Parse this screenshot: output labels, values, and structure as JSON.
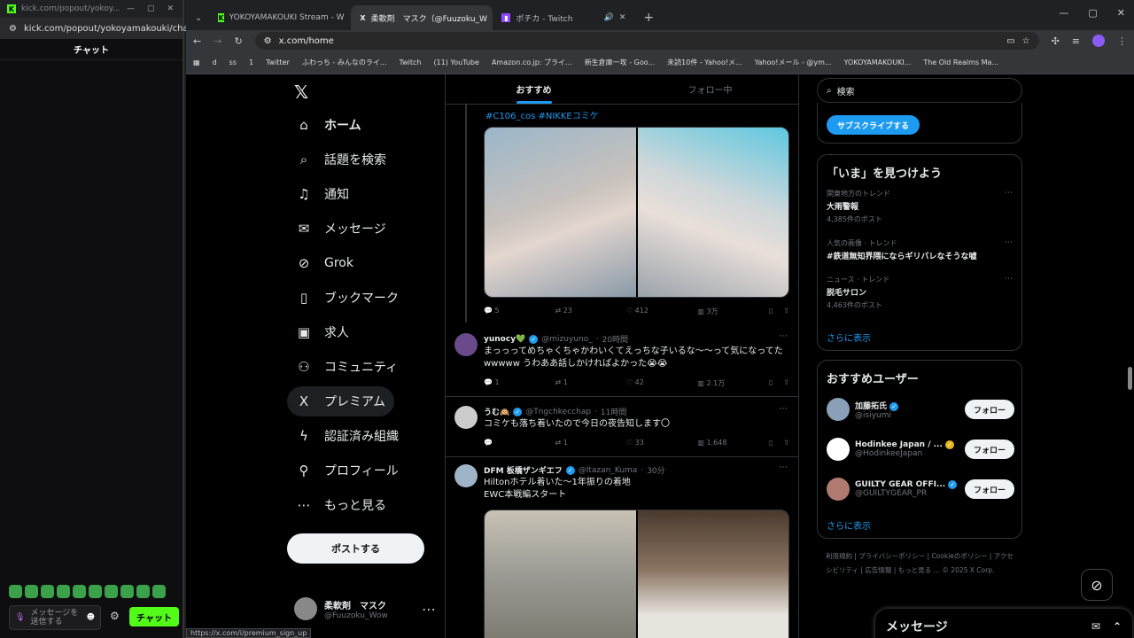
{
  "left_window": {
    "title": "kick.com/popout/yokoy...",
    "url": "kick.com/popout/yokoyamakouki/chat",
    "chat_header": "チャット",
    "input_placeholder": "メッセージを送信する",
    "send_button": "チャット",
    "emote_count": 10
  },
  "browser": {
    "tabs": [
      {
        "label": "YOKOYAMAKOUKI Stream - W",
        "icon": "kick-icon"
      },
      {
        "label": "柔軟剤　マスク（@Fuuzoku_W",
        "icon": "x-icon"
      },
      {
        "label": "ポチカ - Twitch",
        "icon": "twitch-icon"
      }
    ],
    "url": "x.com/home",
    "bookmarks": [
      "d",
      "ss",
      "1",
      "Twitter",
      "ふわっち - みんなのライ...",
      "Twitch",
      "(11) YouTube",
      "Amazon.co.jp: プライ...",
      "新生倉庫一攻 - Goo...",
      "未読10件 - Yahoo!メ...",
      "Yahoo!メール - @ym...",
      "YOKOYAMAKOUKI...",
      "The Old Realms Ma..."
    ],
    "status_url": "https://x.com/i/premium_sign_up"
  },
  "nav": {
    "items": [
      {
        "label": "ホーム",
        "icon": "home-icon",
        "glyph": "⌂"
      },
      {
        "label": "話題を検索",
        "icon": "search-icon",
        "glyph": "⌕"
      },
      {
        "label": "通知",
        "icon": "bell-icon",
        "glyph": "♫"
      },
      {
        "label": "メッセージ",
        "icon": "mail-icon",
        "glyph": "✉"
      },
      {
        "label": "Grok",
        "icon": "grok-icon",
        "glyph": "⊘"
      },
      {
        "label": "ブックマーク",
        "icon": "bookmark-icon",
        "glyph": "▯"
      },
      {
        "label": "求人",
        "icon": "briefcase-icon",
        "glyph": "▣"
      },
      {
        "label": "コミュニティ",
        "icon": "community-icon",
        "glyph": "⚇"
      },
      {
        "label": "プレミアム",
        "icon": "x-premium-icon",
        "glyph": "X"
      },
      {
        "label": "認証済み組織",
        "icon": "bolt-icon",
        "glyph": "ϟ"
      },
      {
        "label": "プロフィール",
        "icon": "person-icon",
        "glyph": "⚲"
      },
      {
        "label": "もっと見る",
        "icon": "more-circle-icon",
        "glyph": "⋯"
      }
    ],
    "post_button": "ポストする",
    "account": {
      "name": "柔軟剤　マスク",
      "handle": "@Fuuzoku_Wow"
    }
  },
  "feed": {
    "tabs": [
      "おすすめ",
      "フォロー中"
    ],
    "first_post": {
      "hashtags": "#C106_cos #NIKKEコミケ",
      "stats": {
        "reply": "5",
        "repost": "23",
        "like": "412",
        "views": "3万"
      }
    },
    "posts": [
      {
        "name": "yunocy💚",
        "handle": "@mizuyuno_",
        "time": "20時間",
        "text": "まっっってめちゃくちゃかわいくてえっちな子いるな〜〜って気になってたwwwww うわああ話しかければよかった😭😭",
        "stats": {
          "reply": "1",
          "repost": "1",
          "like": "42",
          "views": "2.1万"
        },
        "avatar": "#6a4a8a"
      },
      {
        "name": "うむ🙉",
        "handle": "@Tngchkecchap",
        "time": "11時間",
        "text": "コミケも落ち着いたので今日の夜告知します〇",
        "stats": {
          "reply": "",
          "repost": "1",
          "like": "33",
          "views": "1,648"
        },
        "avatar": "#cccccc"
      },
      {
        "name": "DFM 板橋ザンギエフ",
        "handle": "@Itazan_Kuma",
        "time": "30分",
        "text": "Hiltonホテル着いた〜1年振りの着地\nEWC本戦編スタート",
        "avatar": "#a0b4c8"
      }
    ]
  },
  "rail": {
    "search_placeholder": "検索",
    "subscribe_button": "サブスクライブする",
    "trends_title": "「いま」を見つけよう",
    "trends": [
      {
        "category": "関東地方のトレンド",
        "topic": "大雨警報",
        "count": "4,385件のポスト"
      },
      {
        "category": "人気の画像 · トレンド",
        "topic": "#鉄道無知界隈にならギリバレなそうな嘘",
        "count": ""
      },
      {
        "category": "ニュース · トレンド",
        "topic": "脱毛サロン",
        "count": "4,463件のポスト"
      }
    ],
    "show_more": "さらに表示",
    "who_title": "おすすめユーザー",
    "users": [
      {
        "name": "加藤拓氏",
        "handle": "@isiyumi",
        "follow": "フォロー",
        "badge": "#1d9bf0",
        "avatar": "#8aa0b8"
      },
      {
        "name": "Hodinkee Japan / ...",
        "handle": "@HodinkeeJapan",
        "follow": "フォロー",
        "badge": "#e2b719",
        "avatar": "#ffffff"
      },
      {
        "name": "GUILTY GEAR OFFI...",
        "handle": "@GUILTYGEAR_PR",
        "follow": "フォロー",
        "badge": "#1d9bf0",
        "avatar": "#b07a70"
      }
    ],
    "show_more_2": "さらに表示",
    "footer": "利用規約 | プライバシーポリシー | Cookieのポリシー | アクセシビリティ | 広告情報 | もっと見る … © 2025 X Corp."
  },
  "messages_bar": "メッセージ"
}
